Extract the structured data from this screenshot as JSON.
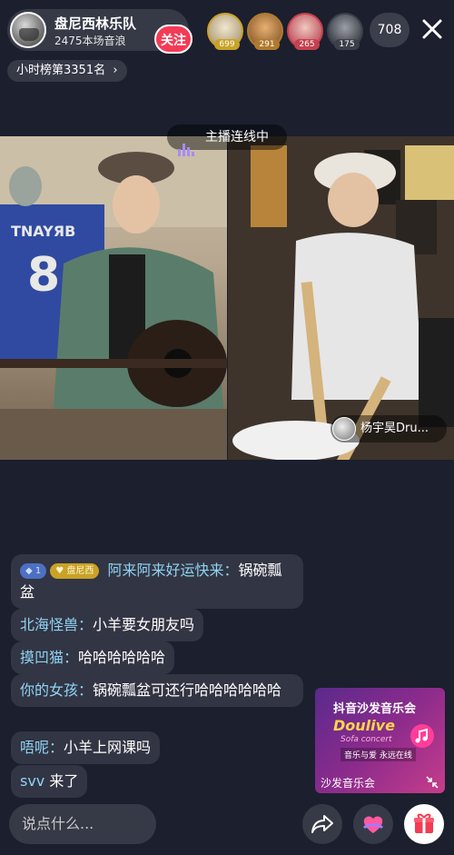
{
  "header": {
    "host_name": "盘尼西林乐队",
    "host_sub": "2475本场音浪",
    "follow_label": "关注",
    "viewers": [
      {
        "badge": "699",
        "color": "#c9a227"
      },
      {
        "badge": "291",
        "color": "#b07a2e"
      },
      {
        "badge": "265",
        "color": "#c6414e"
      },
      {
        "badge": "175",
        "color": "#3b3f4a"
      }
    ],
    "online_count": "708"
  },
  "rank_label": "小时榜第3351名",
  "live_status": "主播连线中",
  "cohost_name": "杨宇昊Dru...",
  "chat": [
    {
      "badges": [
        "1",
        "盘尼西"
      ],
      "user": "阿来阿来好运快来：",
      "text": "锅碗瓢盆"
    },
    {
      "user": "北海怪兽：",
      "text": "小羊要女朋友吗"
    },
    {
      "user": "摸凹猫：",
      "text": "哈哈哈哈哈哈"
    },
    {
      "user": "你的女孩：",
      "text": "锅碗瓢盆可还行哈哈哈哈哈哈"
    },
    {
      "user": "唔呢：",
      "text": "小羊上网课吗"
    },
    {
      "user": "svv",
      "text": " 来了"
    }
  ],
  "promo": {
    "title": "抖音沙发音乐会",
    "brand": "Doulive",
    "brand_sub": "Sofa concert",
    "slogan": "音乐与爱 永远在线",
    "caption": "沙发音乐会"
  },
  "input_placeholder": "说点什么...",
  "colors": {
    "accent": "#f43b56",
    "username": "#8fd3f4",
    "live_icon": "#a78bfa"
  }
}
